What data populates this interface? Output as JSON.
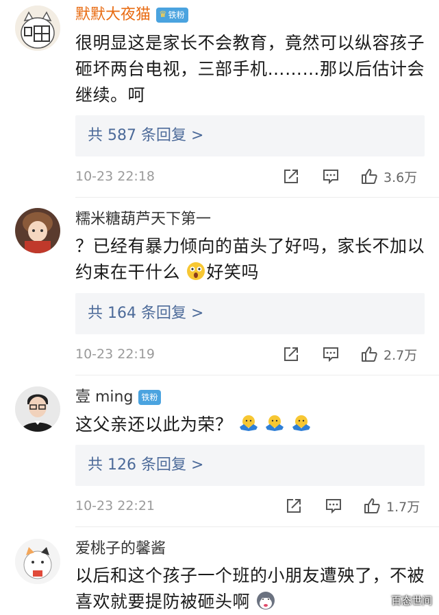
{
  "comments": [
    {
      "name": "默默大夜猫",
      "badge": "铁粉",
      "text": "很明显这是家长不会教育，竟然可以纵容孩子砸坏两台电视，三部手机………那以后估计会继续。呵",
      "replies": "共 587 条回复 >",
      "time": "10-23 22:18",
      "likes": "3.6万"
    },
    {
      "name": "糯米糖葫芦天下第一",
      "text_before": "？已经有暴力倾向的苗头了好吗，家长不加以约束在干什么",
      "text_after": "好笑吗",
      "replies": "共 164 条回复 >",
      "time": "10-23 22:19",
      "likes": "2.7万"
    },
    {
      "name": "壹 ming",
      "badge": "铁粉",
      "text": "这父亲还以此为荣？",
      "replies": "共 126 条回复 >",
      "time": "10-23 22:21",
      "likes": "1.7万"
    },
    {
      "name": "爱桃子的馨酱",
      "text": "以后和这个孩子一个班的小朋友遭殃了，不被喜欢就要提防被砸头啊"
    }
  ],
  "watermark": "百态世间"
}
